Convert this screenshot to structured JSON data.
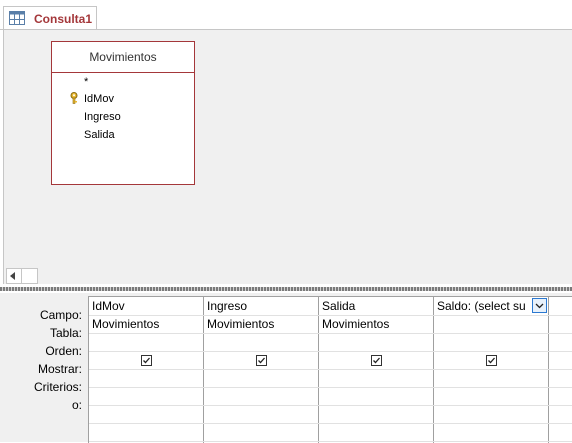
{
  "tab": {
    "label": "Consulta1",
    "icon": "query-icon"
  },
  "table": {
    "title": "Movimientos",
    "fields": [
      {
        "name": "*",
        "key": false
      },
      {
        "name": "IdMov",
        "key": true
      },
      {
        "name": "Ingreso",
        "key": false
      },
      {
        "name": "Salida",
        "key": false
      }
    ]
  },
  "grid": {
    "row_labels": [
      "Campo:",
      "Tabla:",
      "Orden:",
      "Mostrar:",
      "Criterios:",
      "o:"
    ],
    "columns": [
      {
        "campo": "IdMov",
        "tabla": "Movimientos",
        "mostrar": true
      },
      {
        "campo": "Ingreso",
        "tabla": "Movimientos",
        "mostrar": true
      },
      {
        "campo": "Salida",
        "tabla": "Movimientos",
        "mostrar": true
      },
      {
        "campo": "Saldo: (select su",
        "tabla": "",
        "mostrar": true
      }
    ]
  },
  "colors": {
    "accent": "#a4373a",
    "grid_line": "#a0a0a0",
    "dropdown_border": "#2b78d0"
  }
}
